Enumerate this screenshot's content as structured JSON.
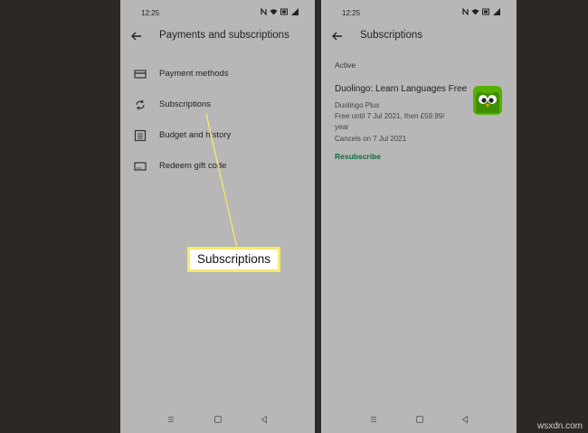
{
  "left_screen": {
    "status": {
      "time": "12:25"
    },
    "title": "Payments and subscriptions",
    "items": [
      {
        "label": "Payment methods",
        "icon": "credit-card-icon"
      },
      {
        "label": "Subscriptions",
        "icon": "sync-icon"
      },
      {
        "label": "Budget and history",
        "icon": "list-icon"
      },
      {
        "label": "Redeem gift code",
        "icon": "gift-card-icon"
      }
    ]
  },
  "right_screen": {
    "status": {
      "time": "12:25"
    },
    "title": "Subscriptions",
    "section_label": "Active",
    "subscription": {
      "name": "Duolingo: Learn Languages Free",
      "plan": "Duolingo Plus",
      "price_line_1": "Free until 7 Jul 2021, then £59.99/",
      "price_line_2": "year",
      "cancel_note": "Cancels on 7 Jul 2021",
      "icon": "duolingo-owl-icon"
    },
    "action_label": "Resubscribe"
  },
  "callout": {
    "label": "Subscriptions",
    "color": "#f7e96a"
  },
  "watermark": "wsxdn.com",
  "colors": {
    "accent": "#0f6b3e",
    "phone_bg": "#b7b7b7",
    "backdrop": "#2b2826",
    "app_icon_bg": "#58b000"
  }
}
